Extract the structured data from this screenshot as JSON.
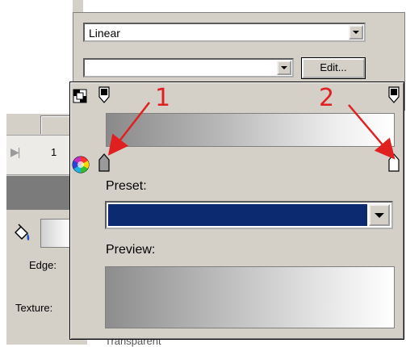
{
  "background": {
    "frame_number": "1",
    "edge_label": "Edge:",
    "texture_label": "Texture:",
    "extra_label": "Transparent"
  },
  "fill_panel": {
    "type_value": "Linear",
    "second_value": "",
    "edit_button": "Edit..."
  },
  "gradient_editor": {
    "preset_label": "Preset:",
    "preview_label": "Preview:",
    "preset_color": "#0b2a6f"
  },
  "annotations": {
    "marker1": "1",
    "marker2": "2"
  }
}
